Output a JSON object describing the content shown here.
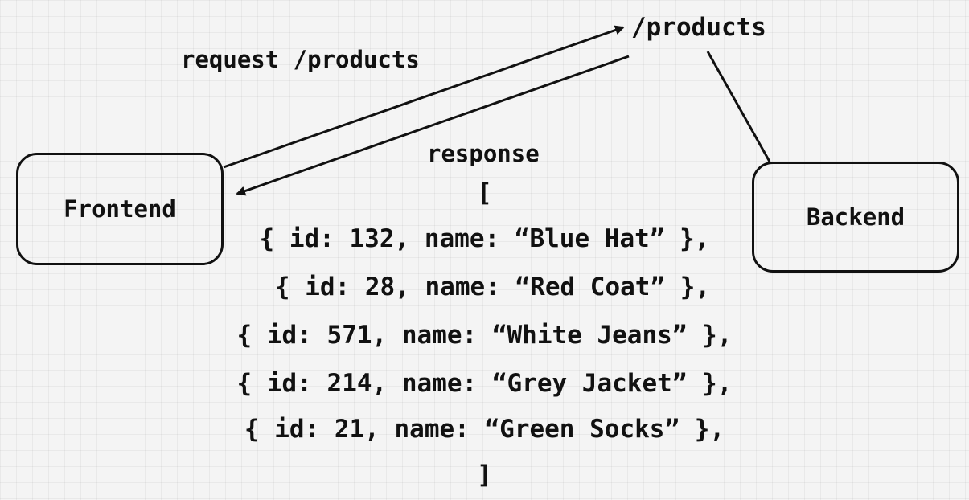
{
  "nodes": {
    "frontend": "Frontend",
    "backend": "Backend"
  },
  "labels": {
    "endpoint": "/products",
    "request": "request /products",
    "response": "response"
  },
  "response_body": {
    "open": "[",
    "close": "]",
    "items": [
      "{ id: 132, name: “Blue Hat” },",
      "{ id: 28, name: “Red Coat” },",
      "{ id: 571, name: “White Jeans” },",
      "{ id: 214, name: “Grey Jacket” },",
      "{ id: 21, name: “Green Socks” },"
    ]
  },
  "colors": {
    "ink": "#111111",
    "background": "#f4f4f4"
  }
}
